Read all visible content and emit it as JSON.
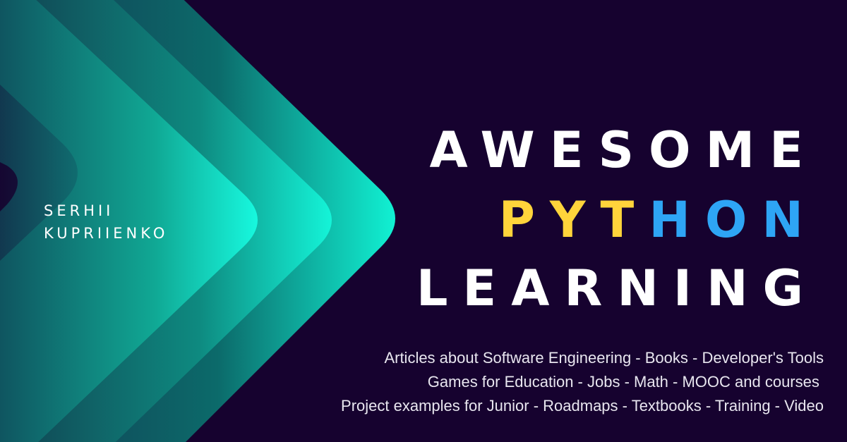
{
  "author": {
    "first": "SERHII",
    "last": "KUPRIIENKO"
  },
  "title": {
    "line1": "AWESOME",
    "line2_part1": "PYT",
    "line2_part2": "HON",
    "line3": "LEARNING"
  },
  "tagline": [
    "Articles about Software Engineering - Books - Developer's Tools",
    "Games for Education - Jobs - Math - MOOC and courses ",
    "Project examples for Junior - Roadmaps - Textbooks - Training - Video"
  ],
  "colors": {
    "background": "#16022f",
    "python_yellow": "#ffd43b",
    "python_blue": "#2ea5f5",
    "teal_bright": "#12f5d6",
    "teal_dark": "#0b3d4d"
  }
}
